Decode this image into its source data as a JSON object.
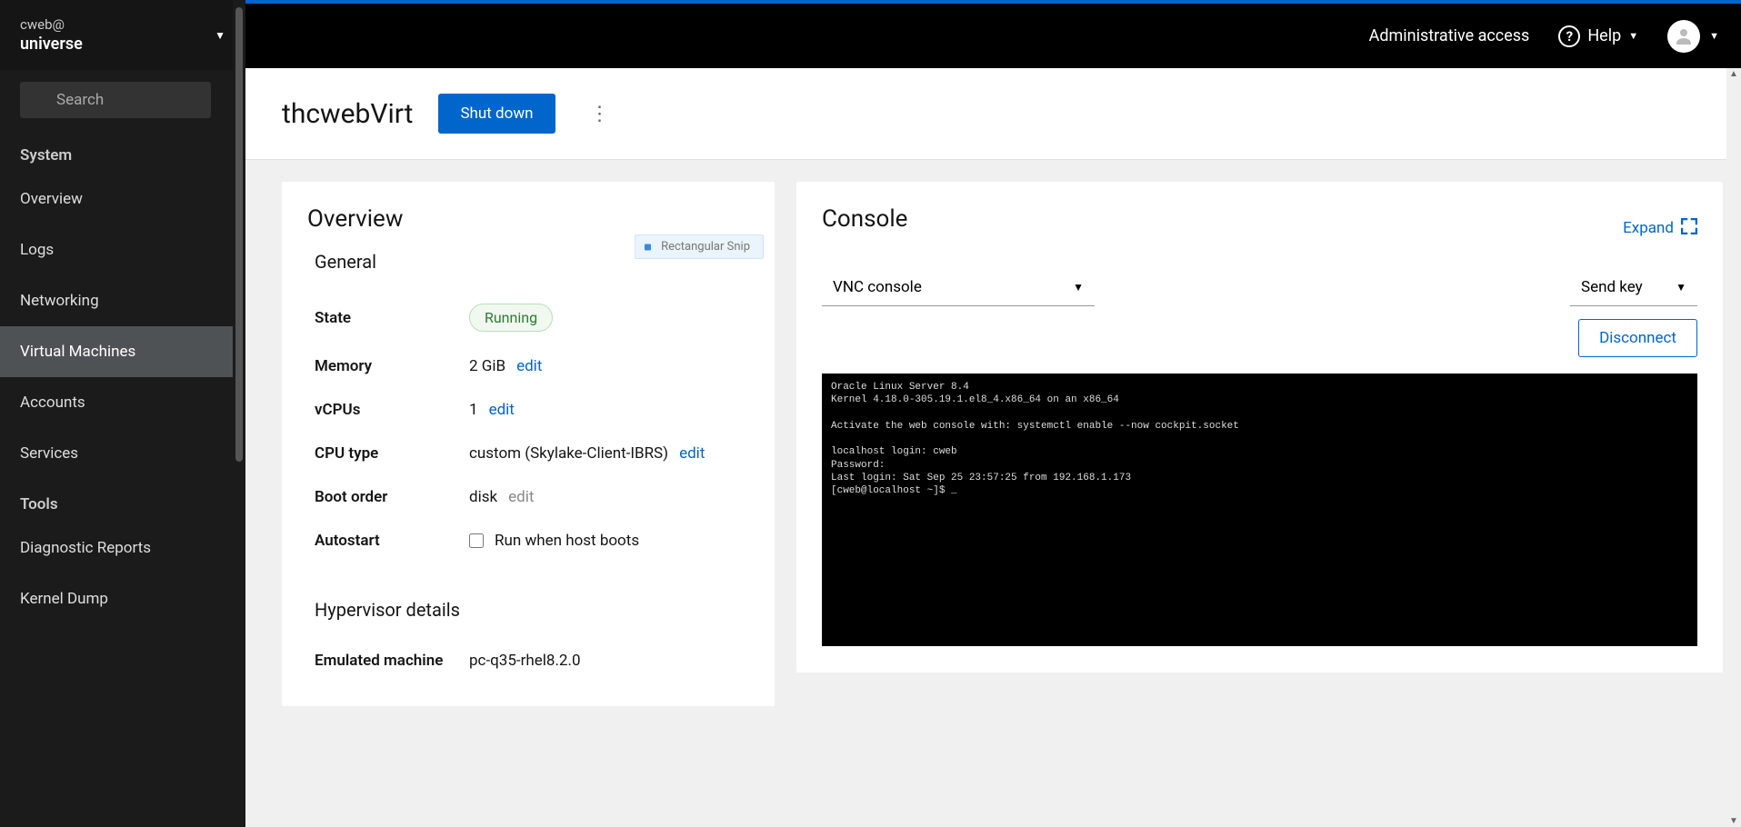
{
  "host": {
    "user": "cweb@",
    "name": "universe"
  },
  "search": {
    "placeholder": "Search"
  },
  "nav": {
    "section1": "System",
    "items1": [
      "Overview",
      "Logs",
      "Networking",
      "Virtual Machines",
      "Accounts",
      "Services"
    ],
    "section2": "Tools",
    "items2": [
      "Diagnostic Reports",
      "Kernel Dump"
    ]
  },
  "topbar": {
    "admin": "Administrative access",
    "help": "Help"
  },
  "vm": {
    "name": "thcwebVirt",
    "shutdown": "Shut down",
    "snip": "Rectangular Snip"
  },
  "overview": {
    "title": "Overview",
    "general": "General",
    "state_label": "State",
    "state_value": "Running",
    "memory_label": "Memory",
    "memory_value": "2 GiB",
    "vcpus_label": "vCPUs",
    "vcpus_value": "1",
    "cputype_label": "CPU type",
    "cputype_value": "custom (Skylake-Client-IBRS)",
    "bootorder_label": "Boot order",
    "bootorder_value": "disk",
    "autostart_label": "Autostart",
    "autostart_value": "Run when host boots",
    "edit": "edit",
    "hypervisor": "Hypervisor details",
    "emu_label": "Emulated machine",
    "emu_value": "pc-q35-rhel8.2.0"
  },
  "console": {
    "title": "Console",
    "expand": "Expand",
    "type": "VNC console",
    "sendkey": "Send key",
    "disconnect": "Disconnect",
    "terminal_lines": [
      "Oracle Linux Server 8.4",
      "Kernel 4.18.0-305.19.1.el8_4.x86_64 on an x86_64",
      "",
      "Activate the web console with: systemctl enable --now cockpit.socket",
      "",
      "localhost login: cweb",
      "Password:",
      "Last login: Sat Sep 25 23:57:25 from 192.168.1.173",
      "[cweb@localhost ~]$ _"
    ]
  }
}
